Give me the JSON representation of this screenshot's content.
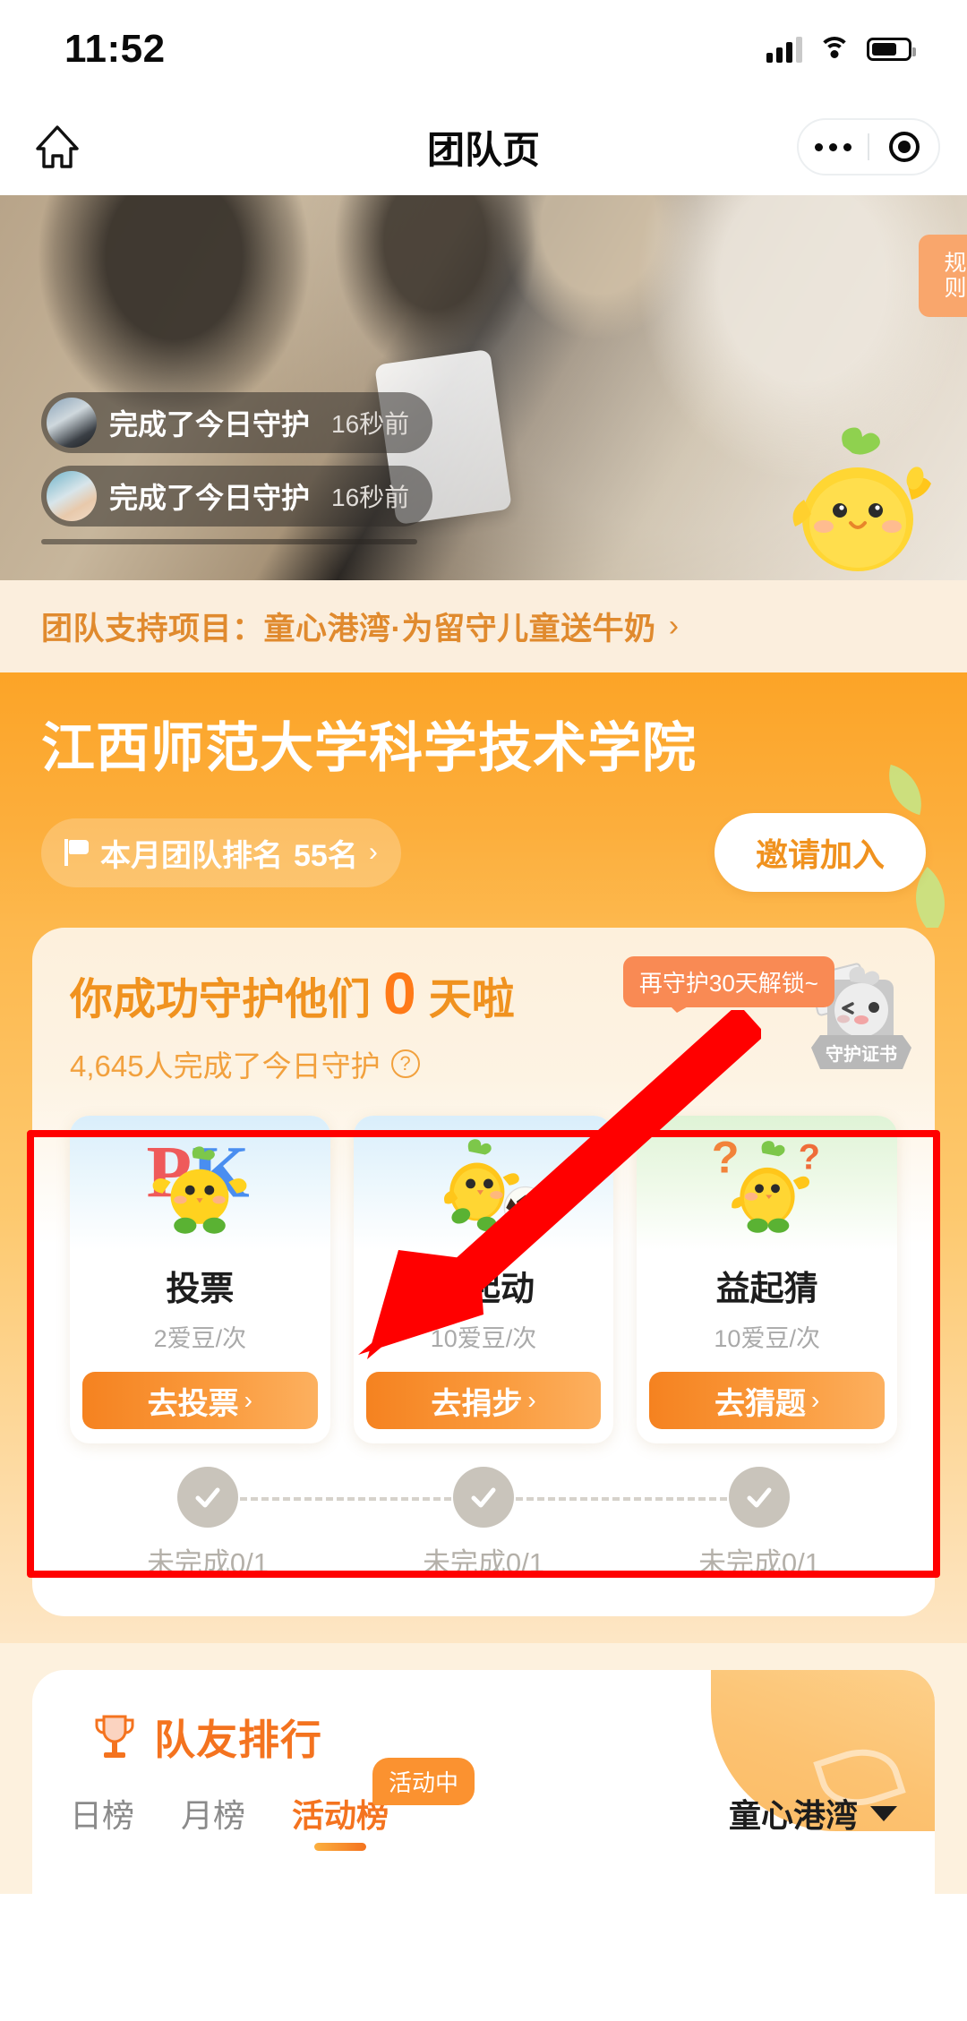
{
  "status_bar": {
    "time": "11:52",
    "signal_icon": "cellular-bars-icon",
    "wifi_icon": "wifi-icon",
    "battery_icon": "battery-icon"
  },
  "nav": {
    "home_icon": "home-icon",
    "title": "团队页",
    "more_icon": "more-dots-icon",
    "target_icon": "target-circle-icon"
  },
  "hero": {
    "rule_tab": "规则",
    "toasts": [
      {
        "text": "完成了今日守护",
        "time": "16秒前"
      },
      {
        "text": "完成了今日守护",
        "time": "16秒前"
      }
    ]
  },
  "project_bar": {
    "label": "团队支持项目：",
    "name": "童心港湾·为留守儿童送牛奶",
    "arrow": "›"
  },
  "team": {
    "name": "江西师范大学科学技术学院",
    "rank_flag_icon": "flag-icon",
    "rank_label": "本月团队排名",
    "rank_value": "55名",
    "rank_arrow": "›",
    "invite_label": "邀请加入"
  },
  "guardian": {
    "headline_prefix": "你成功守护他们",
    "days": "0",
    "headline_suffix": "天啦",
    "subtext": "4,645人完成了今日守护",
    "help_icon": "question-circle-icon",
    "tooltip": "再守护30天解锁~",
    "certificate_label": "守护证书"
  },
  "tasks": [
    {
      "name": "投票",
      "cost": "2爱豆/次",
      "button": "去投票",
      "arrow": "›",
      "icon": "pk-vote-chick-icon",
      "progress": "未完成0/1",
      "check_icon": "check-circle-icon"
    },
    {
      "name": "益起动",
      "cost": "10爱豆/次",
      "button": "去捐步",
      "arrow": "›",
      "icon": "soccer-chick-icon",
      "progress": "未完成0/1",
      "check_icon": "check-circle-icon"
    },
    {
      "name": "益起猜",
      "cost": "10爱豆/次",
      "button": "去猜题",
      "arrow": "›",
      "icon": "question-chick-icon",
      "progress": "未完成0/1",
      "check_icon": "check-circle-icon"
    }
  ],
  "ranking": {
    "trophy_icon": "trophy-icon",
    "title": "队友排行",
    "tabs": [
      {
        "label": "日榜",
        "active": false
      },
      {
        "label": "月榜",
        "active": false
      },
      {
        "label": "活动榜",
        "active": true,
        "badge": "活动中"
      }
    ],
    "project_filter": "童心港湾",
    "caret_icon": "chevron-down-icon"
  },
  "annotation": {
    "box_color": "#ff0000",
    "arrow_color": "#ff0000"
  },
  "colors": {
    "primary_orange": "#f4731f",
    "header_orange": "#fca427",
    "button_gradient_start": "#f58220",
    "button_gradient_end": "#fcb05f",
    "cream": "#fdf1de",
    "muted_gray": "#b4b0a9"
  }
}
